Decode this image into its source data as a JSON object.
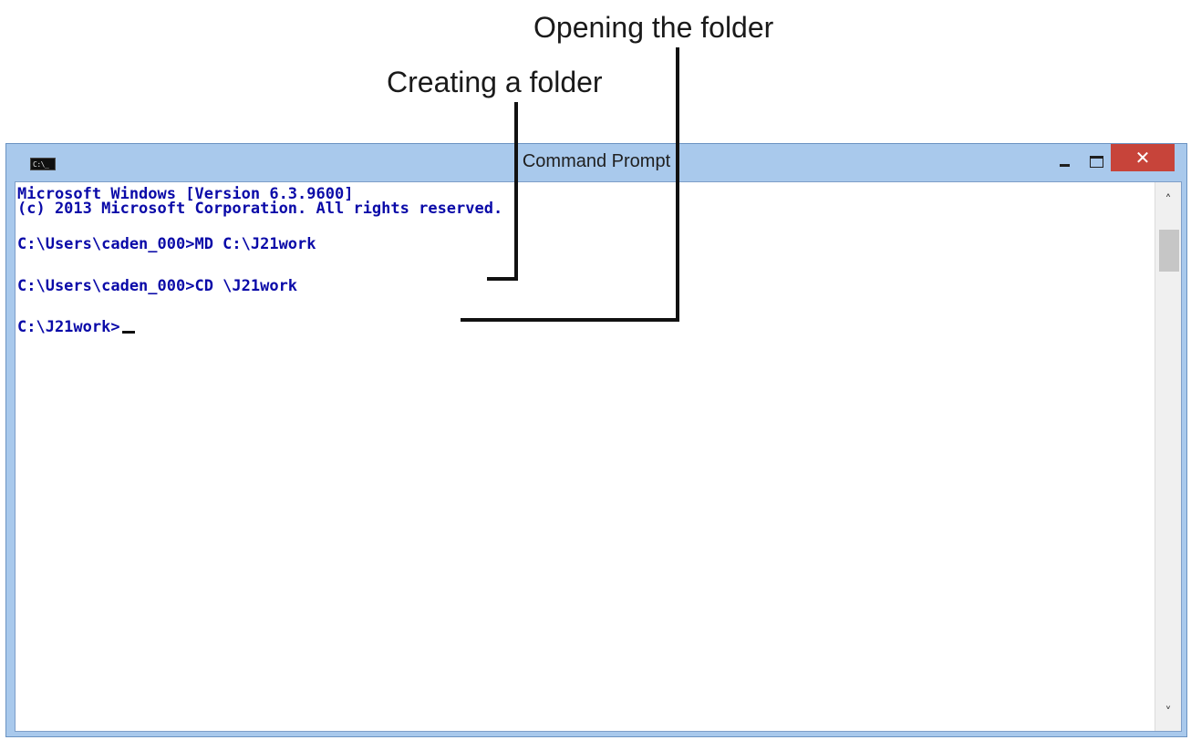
{
  "annotations": {
    "opening_folder": "Opening the folder",
    "creating_folder": "Creating a folder"
  },
  "window": {
    "title": "Command Prompt",
    "icon": "cmd-window-icon",
    "icon_text": "C:\\_",
    "buttons": {
      "minimize": "minimize-icon",
      "maximize": "maximize-icon",
      "close": "close-icon",
      "close_glyph": "✕"
    }
  },
  "console": {
    "lines": [
      "Microsoft Windows [Version 6.3.9600]",
      "(c) 2013 Microsoft Corporation. All rights reserved.",
      "C:\\Users\\caden_000>MD C:\\J21work",
      "C:\\Users\\caden_000>CD \\J21work",
      "C:\\J21work>"
    ],
    "text_color": "#0a0aa8"
  },
  "scrollbar": {
    "up_glyph": "˄",
    "down_glyph": "˅"
  },
  "colors": {
    "titlebar": "#a9c9ec",
    "close_button": "#c7443a",
    "callout_line": "#111111"
  }
}
